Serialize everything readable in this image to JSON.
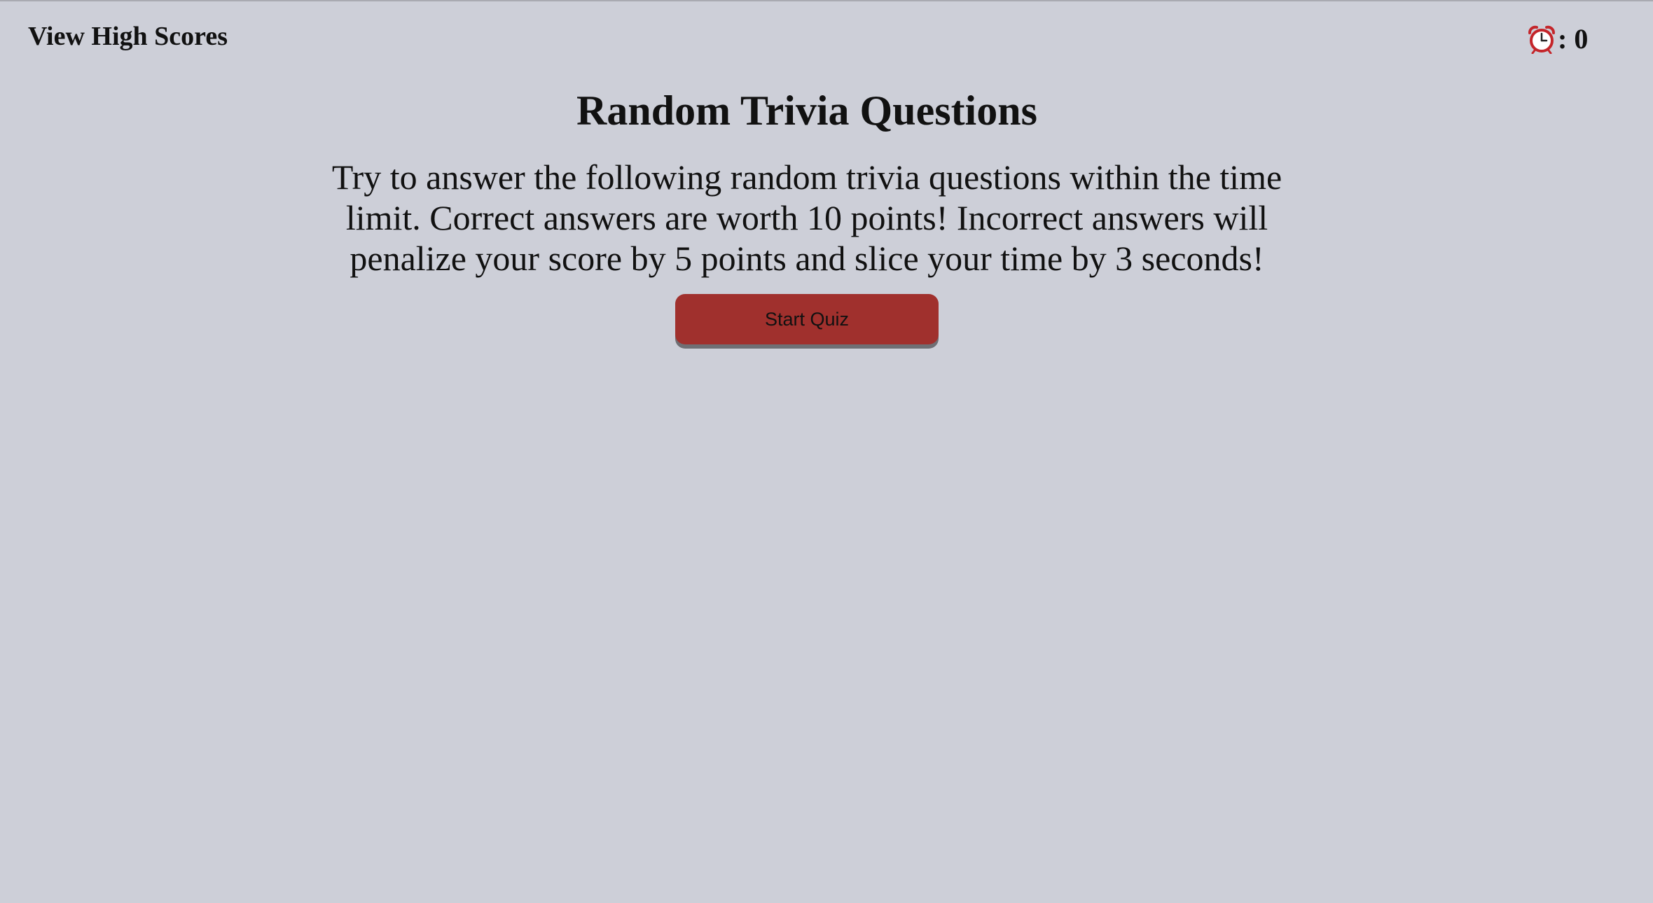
{
  "header": {
    "high_scores_link": "View High Scores",
    "timer_icon": "alarm-clock-icon",
    "timer_separator": ":",
    "timer_value": "0"
  },
  "main": {
    "title": "Random Trivia Questions",
    "intro": "Try to answer the following random trivia questions within the time limit. Correct answers are worth 10 points! Incorrect answers will penalize your score by 5 points and slice your time by 3 seconds!",
    "start_button": "Start Quiz"
  },
  "colors": {
    "background": "#cdcfd8",
    "button": "#a0302d",
    "button_shadow": "#6f6f74",
    "timer_icon": "#c4252a",
    "text": "#111111"
  }
}
